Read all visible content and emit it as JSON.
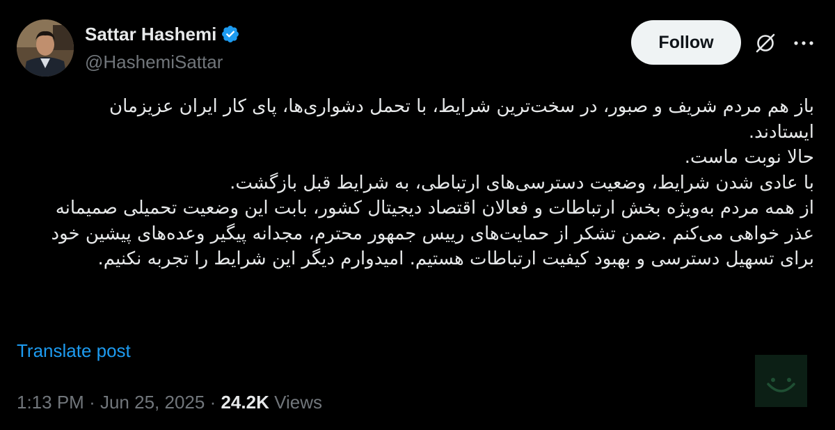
{
  "author": {
    "display_name": "Sattar Hashemi",
    "handle": "@HashemiSattar",
    "verified": true
  },
  "actions": {
    "follow_label": "Follow",
    "grok_icon": "grok-slash-circle-icon",
    "more_icon": "more-horizontal-icon"
  },
  "post": {
    "lines": [
      "باز هم مردم شریف و صبور، در سخت‌ترین شرایط، با تحمل دشواری‌ها، پای کار ایران عزیزمان",
      "ایستادند.",
      "حالا نوبت ماست.",
      "با عادی شدن شرایط، وضعیت دسترسی‌های ارتباطی، به شرایط قبل بازگشت.",
      "از همه مردم به‌ویژه بخش ارتباطات و فعالان اقتصاد دیجیتال کشور، بابت این وضعیت تحمیلی صمیمانه",
      "عذر خواهی می‌کنم .ضمن تشکر از حمایت‌های رییس جمهور محترم، مجدانه پیگیر وعده‌های پیشین خود",
      "برای تسهیل دسترسی و بهبود کیفیت ارتباطات هستیم. امیدوارم دیگر این شرایط را تجربه نکنیم."
    ],
    "translate_label": "Translate post"
  },
  "meta": {
    "time": "1:13 PM",
    "separator": "·",
    "date": "Jun 25, 2025",
    "views_count": "24.2K",
    "views_label": "Views"
  },
  "colors": {
    "background": "#000000",
    "text_primary": "#e7e9ea",
    "text_secondary": "#71767b",
    "link": "#1d9bf0",
    "verified_badge": "#1d9bf0",
    "follow_bg": "#eff3f4",
    "emoji_widget_bg": "#0c1f15",
    "emoji_widget_fg": "#1f4f33"
  },
  "overlay": {
    "icon": "smiley-face-icon"
  }
}
